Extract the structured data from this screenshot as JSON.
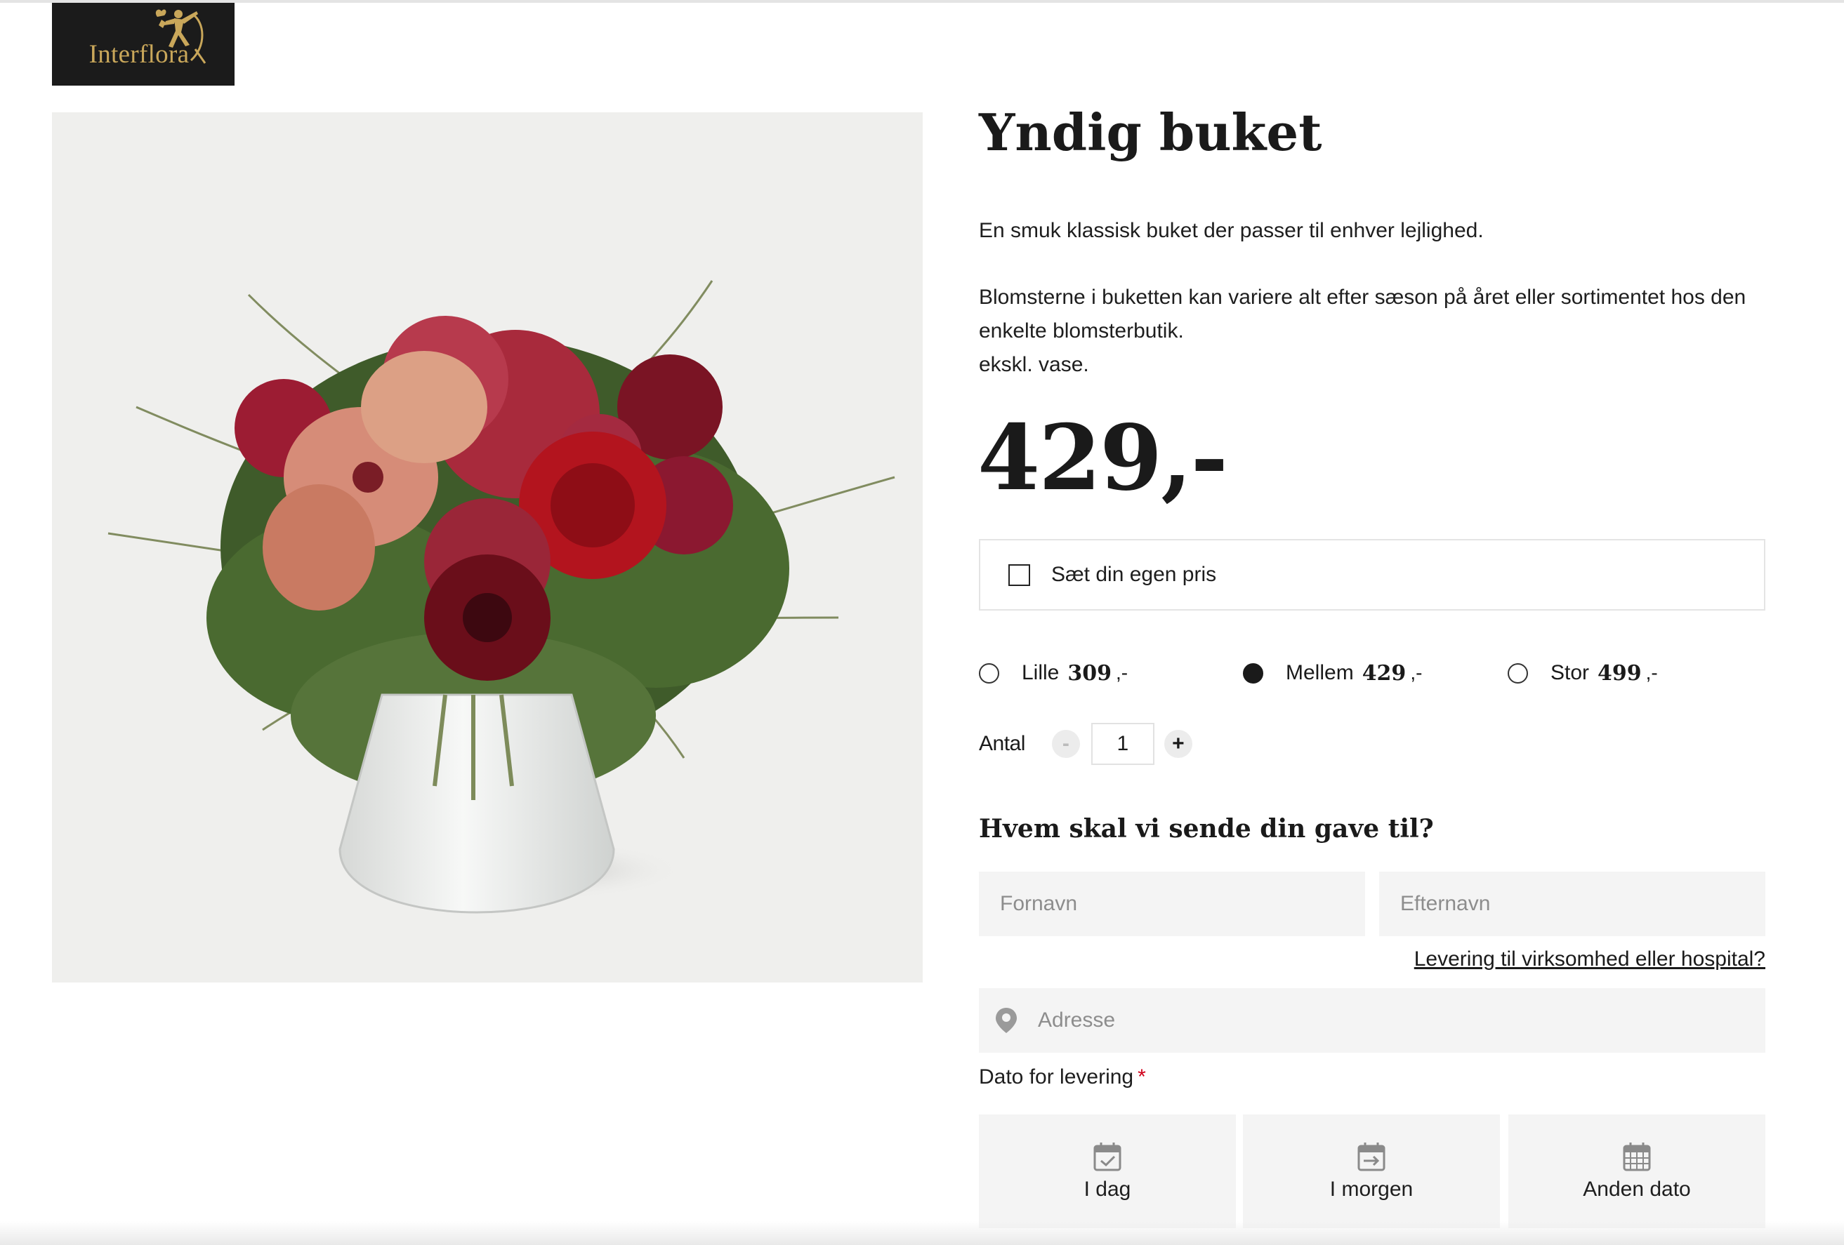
{
  "brand": {
    "logo_text": "Interflora",
    "logo_bg": "#1b1b1b",
    "logo_color": "#c9a75a"
  },
  "product": {
    "title": "Yndig buket",
    "description_1": "En smuk klassisk buket der passer til enhver lejlighed.",
    "description_2": "Blomsterne i buketten kan variere alt efter sæson på året eller sortimentet hos den enkelte blomsterbutik.",
    "description_3": "ekskl. vase.",
    "price": "429,-",
    "image": "bouquet-in-glass-vase"
  },
  "own_price": {
    "label": "Sæt din egen pris",
    "checked": false
  },
  "sizes": [
    {
      "name": "Lille",
      "price": "309",
      "suffix": ",-",
      "selected": false
    },
    {
      "name": "Mellem",
      "price": "429",
      "suffix": ",-",
      "selected": true
    },
    {
      "name": "Stor",
      "price": "499",
      "suffix": ",-",
      "selected": false
    }
  ],
  "quantity": {
    "label": "Antal",
    "value": "1",
    "minus": "-",
    "plus": "+"
  },
  "recipient": {
    "heading": "Hvem skal vi sende din gave til?",
    "first_name_placeholder": "Fornavn",
    "last_name_placeholder": "Efternavn",
    "business_link": "Levering til virksomhed eller hospital?",
    "address_placeholder": "Adresse"
  },
  "delivery": {
    "label": "Dato for levering",
    "required_mark": "*",
    "options": [
      "I dag",
      "I morgen",
      "Anden dato"
    ]
  },
  "colors": {
    "text": "#1a1a1a",
    "required": "#d0021b",
    "field_bg": "#f4f4f4"
  }
}
